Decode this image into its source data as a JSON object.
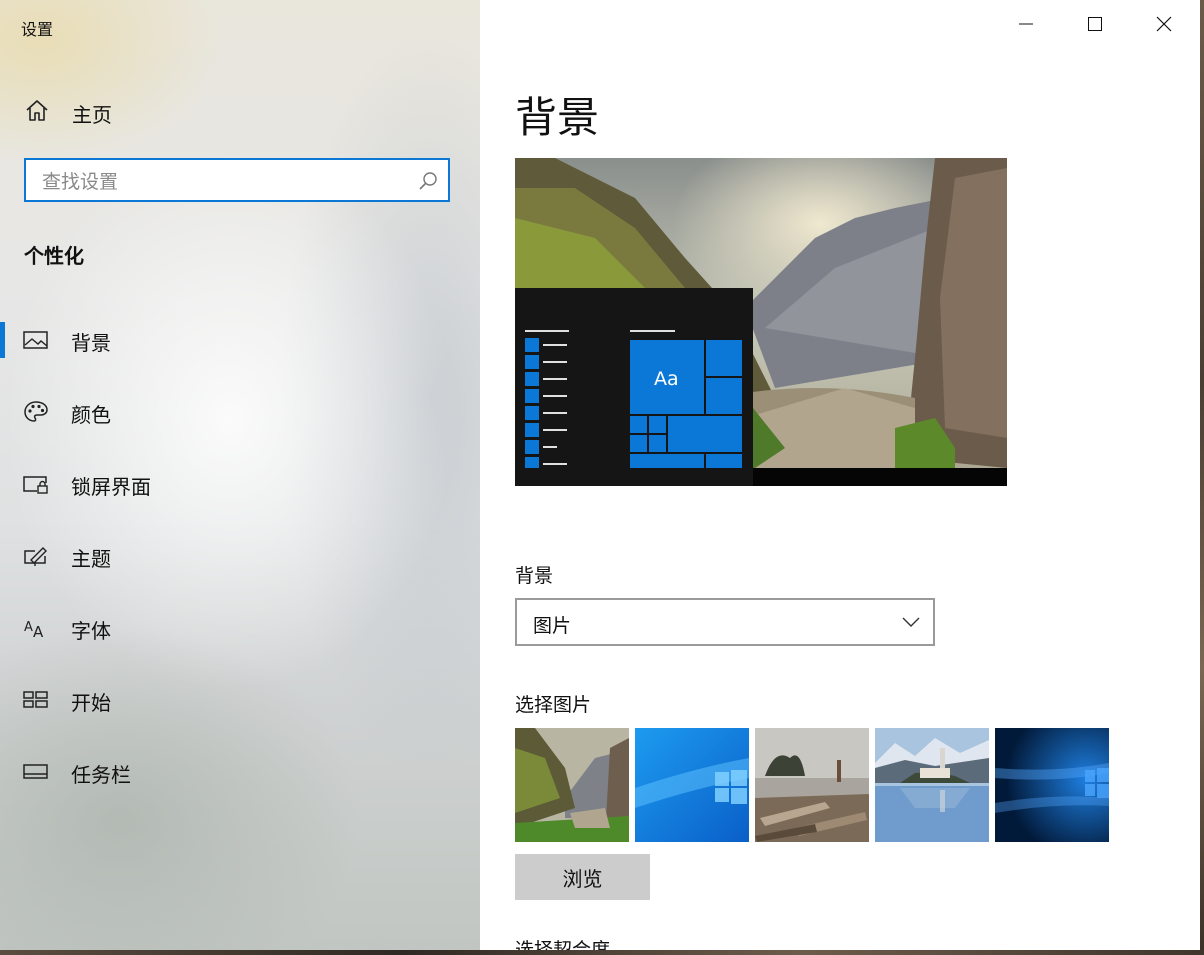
{
  "window": {
    "app_title": "设置"
  },
  "sidebar": {
    "home_label": "主页",
    "search_placeholder": "查找设置",
    "section_title": "个性化",
    "items": [
      {
        "label": "背景",
        "icon": "picture-icon",
        "selected": true
      },
      {
        "label": "颜色",
        "icon": "palette-icon",
        "selected": false
      },
      {
        "label": "锁屏界面",
        "icon": "lock-screen-icon",
        "selected": false
      },
      {
        "label": "主题",
        "icon": "theme-brush-icon",
        "selected": false
      },
      {
        "label": "字体",
        "icon": "font-icon",
        "selected": false
      },
      {
        "label": "开始",
        "icon": "start-grid-icon",
        "selected": false
      },
      {
        "label": "任务栏",
        "icon": "taskbar-icon",
        "selected": false
      }
    ]
  },
  "main": {
    "page_title": "背景",
    "preview": {
      "sample_text": "Aa"
    },
    "background_label": "背景",
    "background_value": "图片",
    "choose_picture_label": "选择图片",
    "browse_label": "浏览",
    "next_section_label": "选择契合度"
  },
  "colors": {
    "accent": "#0a78d4",
    "tile": "#0b78d7",
    "button_gray": "#cccccc"
  }
}
